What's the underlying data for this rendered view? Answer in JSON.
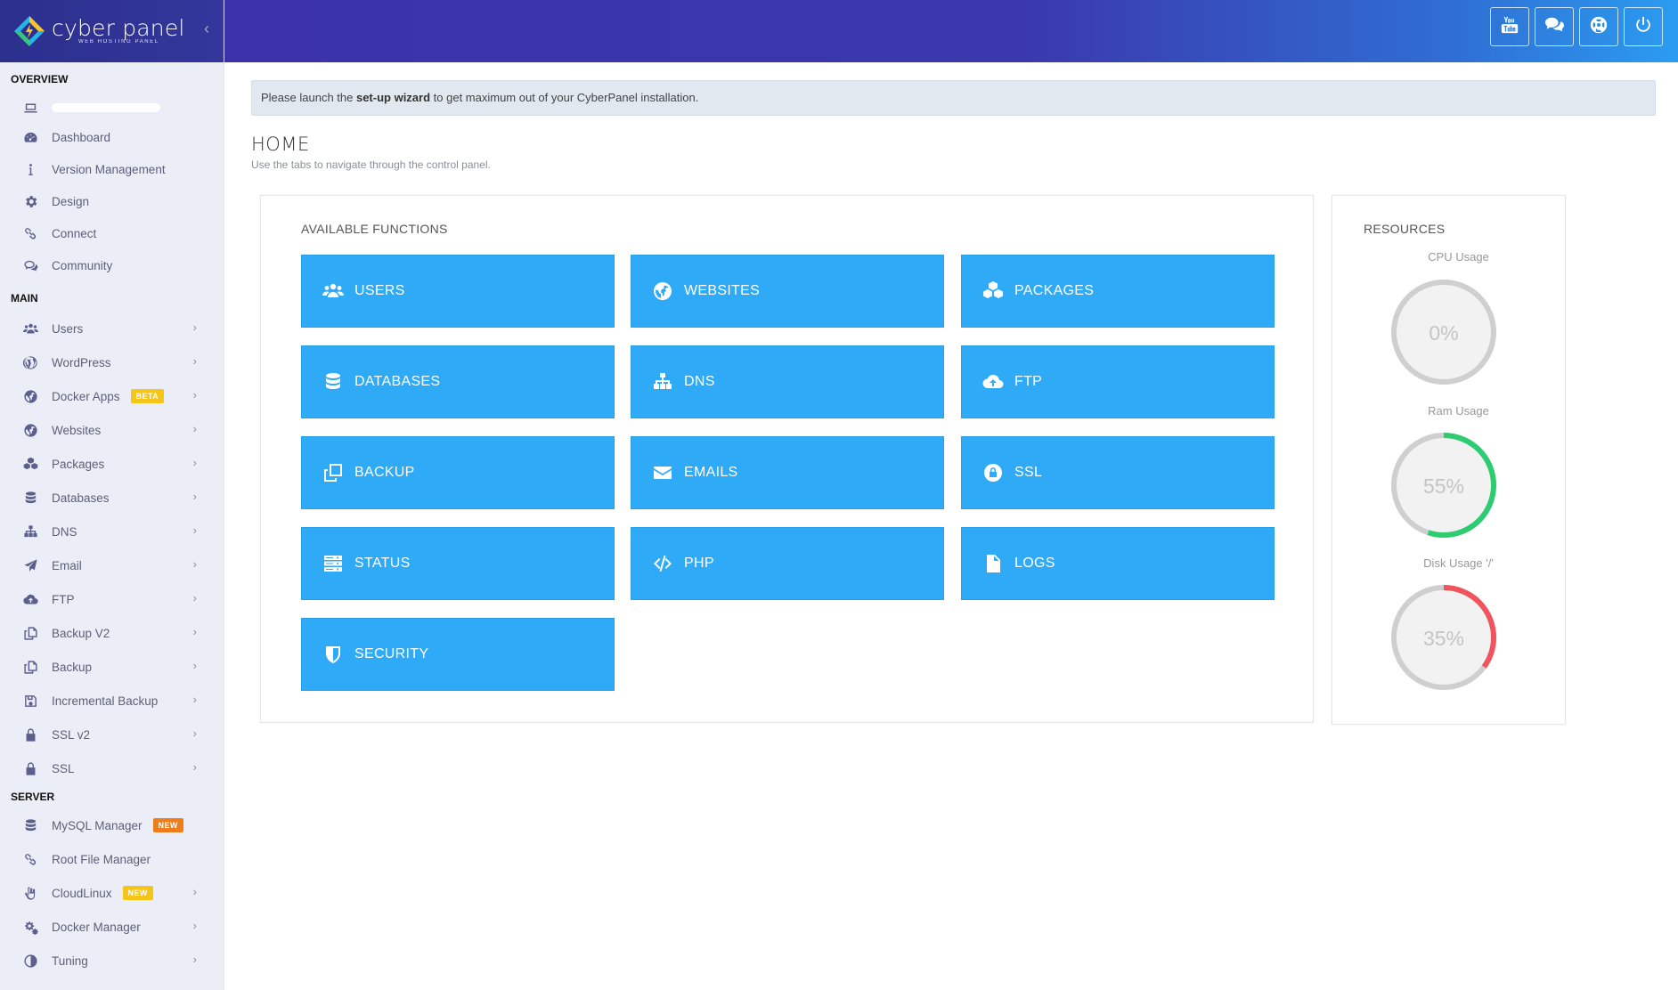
{
  "brand": {
    "name": "cyber panel",
    "tagline": "WEB HOSTING PANEL"
  },
  "sidebar": {
    "sections": {
      "overview": "OVERVIEW",
      "main": "MAIN",
      "server": "SERVER"
    },
    "overview_items": [
      {
        "label": "",
        "icon": "laptop-icon"
      },
      {
        "label": "Dashboard",
        "icon": "dashboard-icon"
      },
      {
        "label": "Version Management",
        "icon": "info-icon"
      },
      {
        "label": "Design",
        "icon": "gear-icon"
      },
      {
        "label": "Connect",
        "icon": "link-icon"
      },
      {
        "label": "Community",
        "icon": "chat-icon"
      }
    ],
    "main_items": [
      {
        "label": "Users",
        "icon": "users-icon"
      },
      {
        "label": "WordPress",
        "icon": "wordpress-icon"
      },
      {
        "label": "Docker Apps",
        "icon": "globe-icon",
        "badge": "BETA"
      },
      {
        "label": "Websites",
        "icon": "globe-icon"
      },
      {
        "label": "Packages",
        "icon": "cubes-icon"
      },
      {
        "label": "Databases",
        "icon": "database-icon"
      },
      {
        "label": "DNS",
        "icon": "sitemap-icon"
      },
      {
        "label": "Email",
        "icon": "paper-plane-icon"
      },
      {
        "label": "FTP",
        "icon": "cloud-upload-icon"
      },
      {
        "label": "Backup V2",
        "icon": "copy-icon"
      },
      {
        "label": "Backup",
        "icon": "copy-icon"
      },
      {
        "label": "Incremental Backup",
        "icon": "save-icon"
      },
      {
        "label": "SSL v2",
        "icon": "lock-icon"
      },
      {
        "label": "SSL",
        "icon": "lock-icon"
      }
    ],
    "server_items": [
      {
        "label": "MySQL Manager",
        "icon": "database-icon",
        "badge": "NEW"
      },
      {
        "label": "Root File Manager",
        "icon": "link-icon"
      },
      {
        "label": "CloudLinux",
        "icon": "hand-icon",
        "badge": "NEW"
      },
      {
        "label": "Docker Manager",
        "icon": "cogs-icon"
      },
      {
        "label": "Tuning",
        "icon": "adjust-icon"
      }
    ]
  },
  "topbar": {
    "buttons": [
      "youtube-icon",
      "comments-icon",
      "life-ring-icon",
      "power-icon"
    ]
  },
  "alert": {
    "prefix": "Please launch the ",
    "link": "set-up wizard",
    "suffix": " to get maximum out of your CyberPanel installation."
  },
  "page": {
    "title": "HOME",
    "subtitle": "Use the tabs to navigate through the control panel."
  },
  "functions": {
    "title": "AVAILABLE FUNCTIONS",
    "items": [
      {
        "label": "USERS",
        "icon": "users-icon"
      },
      {
        "label": "WEBSITES",
        "icon": "globe-icon"
      },
      {
        "label": "PACKAGES",
        "icon": "cubes-icon"
      },
      {
        "label": "DATABASES",
        "icon": "database-icon"
      },
      {
        "label": "DNS",
        "icon": "sitemap-icon"
      },
      {
        "label": "FTP",
        "icon": "cloud-upload-icon"
      },
      {
        "label": "BACKUP",
        "icon": "copy-icon"
      },
      {
        "label": "EMAILS",
        "icon": "envelope-icon"
      },
      {
        "label": "SSL",
        "icon": "lock-icon"
      },
      {
        "label": "STATUS",
        "icon": "server-icon"
      },
      {
        "label": "PHP",
        "icon": "code-icon"
      },
      {
        "label": "LOGS",
        "icon": "file-icon"
      },
      {
        "label": "SECURITY",
        "icon": "shield-icon"
      }
    ]
  },
  "resources": {
    "title": "RESOURCES",
    "gauges": [
      {
        "label": "CPU Usage",
        "text": "0%",
        "value": 0,
        "color": "#cccccc"
      },
      {
        "label": "Ram Usage",
        "text": "55%",
        "value": 55,
        "color": "#2ecc71"
      },
      {
        "label": "Disk Usage '/'",
        "text": "35%",
        "value": 35,
        "color": "#f0545c"
      }
    ]
  },
  "colors": {
    "accent": "#2faaf7",
    "topbar": "#3b32a9",
    "sidebar": "#eceef7",
    "badge_yellow": "#f5c518",
    "badge_orange": "#ef7d1a"
  }
}
